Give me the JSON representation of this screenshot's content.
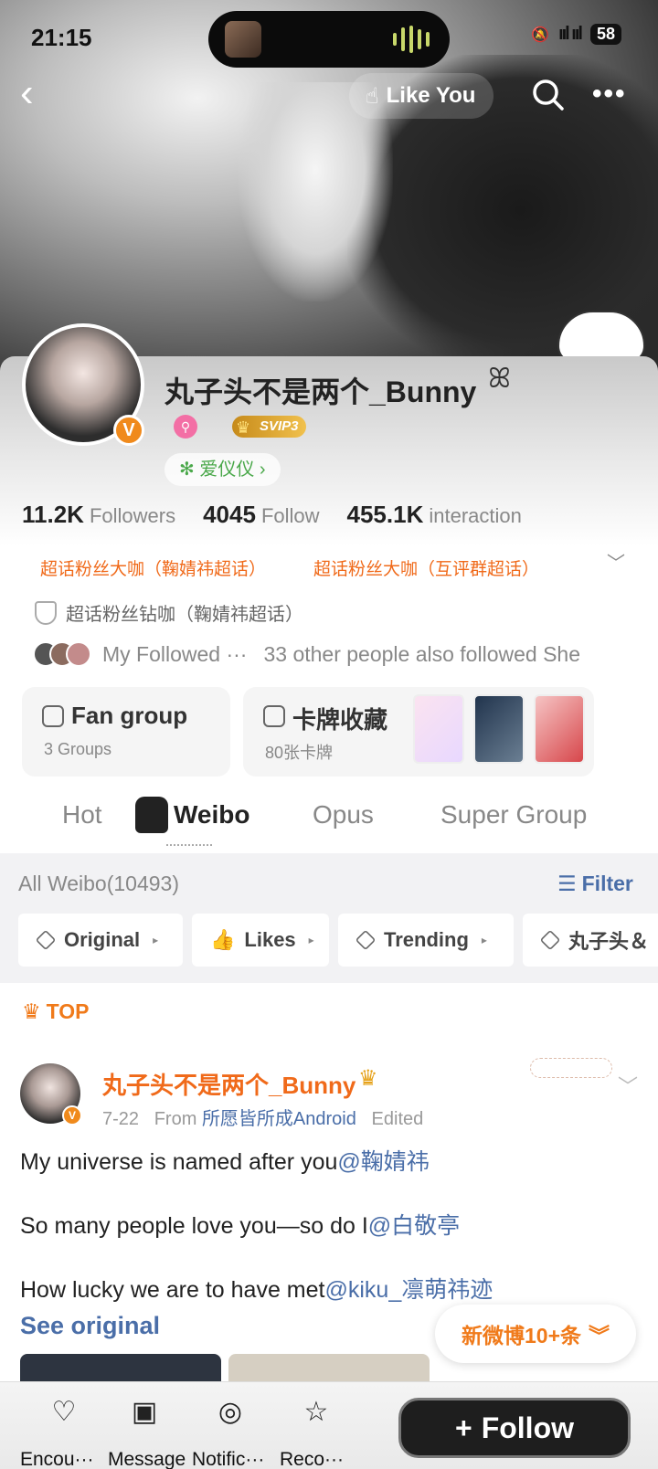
{
  "status": {
    "time": "21:15",
    "battery": "58",
    "signal": "ııl ııl"
  },
  "nav": {
    "like_label": "Like You",
    "back_icon": "back-arrow-icon",
    "search_icon": "search-icon",
    "more_icon": "more-icon"
  },
  "profile": {
    "username": "丸子头不是两个_Bunny",
    "name_mark": "ꕤ",
    "verified": "V",
    "svip": "SVIP3",
    "idol_label": "✻ 爱仪仪 ›",
    "stats": [
      {
        "num": "11.2K",
        "label": "Followers"
      },
      {
        "num": "4045",
        "label": "Follow"
      },
      {
        "num": "455.1K",
        "label": "interaction"
      }
    ],
    "fan_tags": [
      "超话粉丝大咖（鞠婧祎超话）",
      "超话粉丝大咖（互评群超话）"
    ],
    "diamond_tag": "超话粉丝钻咖（鞠婧祎超话）",
    "followed_text": "My Followed ···",
    "others_text": "33 other people also followed She",
    "fan_group": {
      "title": "Fan group",
      "sub": "3 Groups"
    },
    "collection": {
      "title": "卡牌收藏",
      "sub": "80张卡牌"
    }
  },
  "tabs": {
    "hot": "Hot",
    "weibo": "Weibo",
    "opus": "Opus",
    "super": "Super Group"
  },
  "feed": {
    "all_weibo": "All Weibo(10493)",
    "filter": "Filter",
    "chips": [
      "Original",
      "Likes",
      "Trending",
      "丸子头＆"
    ],
    "top_label": "TOP"
  },
  "post": {
    "author": "丸子头不是两个_Bunny",
    "date": "7-22",
    "from_label": "From",
    "source": "所愿皆所成Android",
    "edited": "Edited",
    "lines": [
      {
        "text": "My universe is named after you",
        "mention": "@鞠婧祎"
      },
      {
        "text": "So many people love you—so do I",
        "mention": "@白敬亭"
      },
      {
        "text": "How lucky we are to have met",
        "mention": "@kiku_凛萌祎迹"
      }
    ],
    "see_original": "See original"
  },
  "new_posts": "新微博10+条",
  "bottom": {
    "items": [
      "Encou···",
      "Message",
      "Notific···",
      "Reco···"
    ],
    "follow": "Follow"
  },
  "colors": {
    "accent_orange": "#f06a1a",
    "link_blue": "#4a6ea8"
  }
}
